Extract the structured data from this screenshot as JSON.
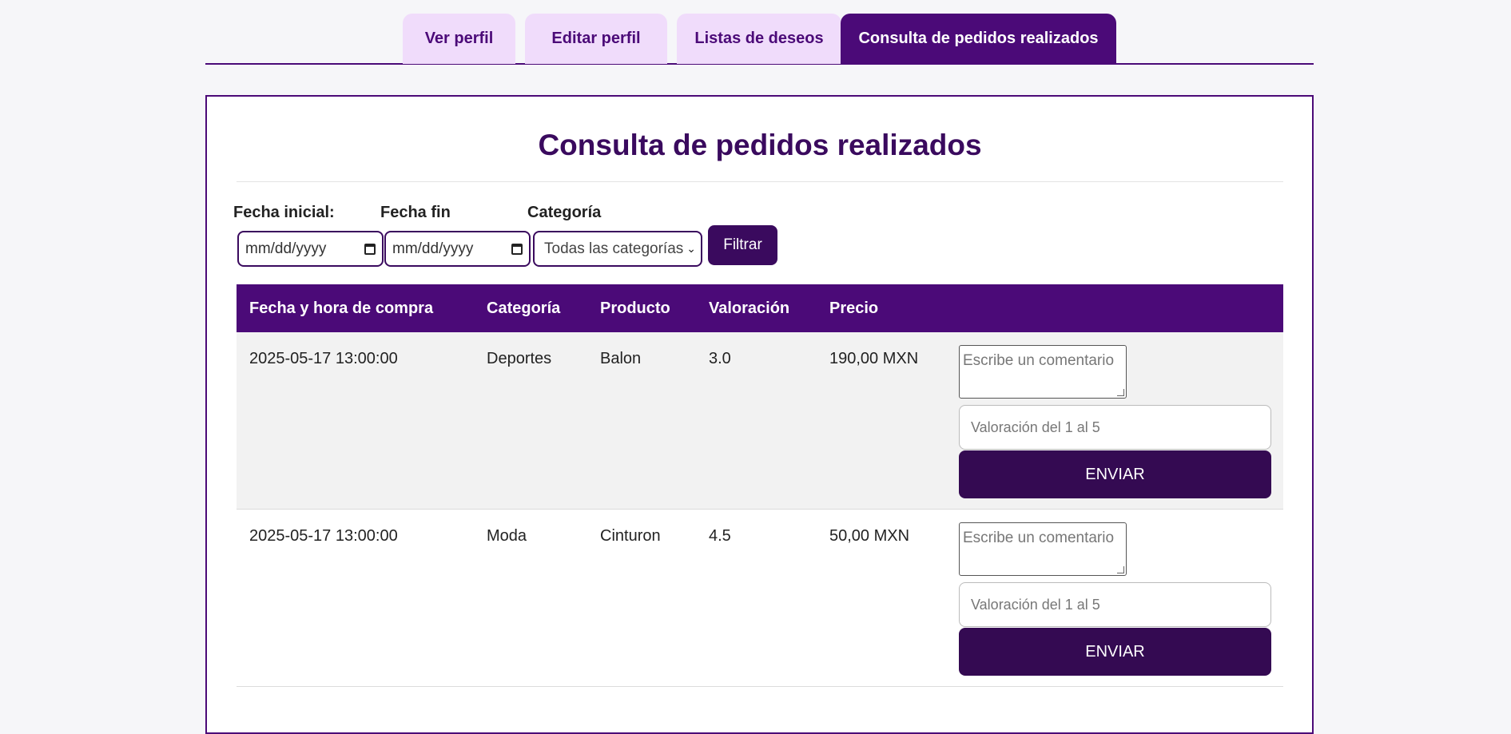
{
  "tabs": [
    {
      "label": "Ver perfil",
      "active": false
    },
    {
      "label": "Editar perfil",
      "active": false
    },
    {
      "label": "Listas de deseos",
      "active": false
    },
    {
      "label": "Consulta de pedidos realizados",
      "active": true
    }
  ],
  "page": {
    "title": "Consulta de pedidos realizados"
  },
  "filters": {
    "start_label": "Fecha inicial:",
    "end_label": "Fecha fin",
    "category_label": "Categoría",
    "start_placeholder": "mm/dd/yyyy",
    "end_placeholder": "mm/dd/yyyy",
    "category_value": "Todas las categorías",
    "filter_button": "Filtrar"
  },
  "table": {
    "headers": [
      "Fecha y hora de compra",
      "Categoría",
      "Producto",
      "Valoración",
      "Precio"
    ],
    "rows": [
      {
        "datetime": "2025-05-17 13:00:00",
        "category": "Deportes",
        "product": "Balon",
        "rating": "3.0",
        "price": "190,00 MXN",
        "comment_placeholder": "Escribe un comentario",
        "rating_placeholder": "Valoración del 1 al 5",
        "send": "ENVIAR"
      },
      {
        "datetime": "2025-05-17 13:00:00",
        "category": "Moda",
        "product": "Cinturon",
        "rating": "4.5",
        "price": "50,00 MXN",
        "comment_placeholder": "Escribe un comentario",
        "rating_placeholder": "Valoración del 1 al 5",
        "send": "ENVIAR"
      }
    ]
  },
  "colors": {
    "primary": "#4b0a78",
    "dark": "#340a52",
    "tab_bg": "#f0dcfb",
    "row_alt": "#f2f2f2"
  }
}
